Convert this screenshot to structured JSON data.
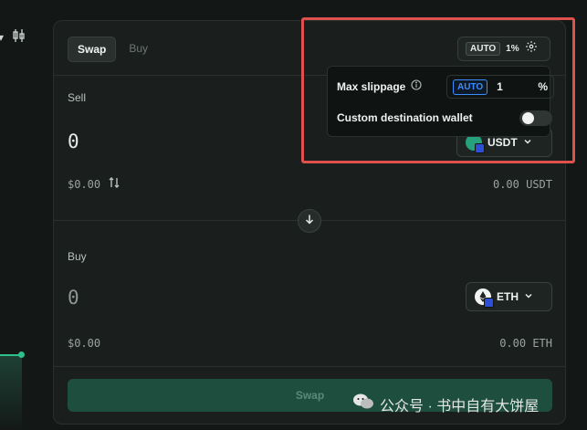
{
  "tabs": [
    {
      "label": "Swap",
      "active": true
    },
    {
      "label": "Buy",
      "active": false
    }
  ],
  "settings": {
    "auto_label": "AUTO",
    "slippage_short": "1%"
  },
  "popover": {
    "max_slippage_label": "Max slippage",
    "auto_label": "AUTO",
    "slippage_value": "1",
    "percent_symbol": "%",
    "custom_destination_label": "Custom destination wallet",
    "custom_destination_enabled": false
  },
  "sell": {
    "label": "Sell",
    "amount": "0",
    "fiat": "$0.00",
    "token": "USDT",
    "balance": "0.00 USDT"
  },
  "buy": {
    "label": "Buy",
    "amount": "0",
    "fiat": "$0.00",
    "token": "ETH",
    "balance": "0.00 ETH"
  },
  "submit_label": "Swap",
  "watermark": "公众号 · 书中自有大饼屋",
  "colors": {
    "accent_auto": "#3b8cff",
    "highlight": "#e0504c",
    "usdt": "#26a17b",
    "chart_green": "#2fbf8a",
    "submit_bg": "#1d4e3e"
  },
  "icons": {
    "gear": "gear-icon",
    "info": "info-icon",
    "swap_direction": "arrow-down-icon",
    "fiat_toggle": "swap-vertical-icon",
    "chevron": "chevron-down-icon"
  }
}
